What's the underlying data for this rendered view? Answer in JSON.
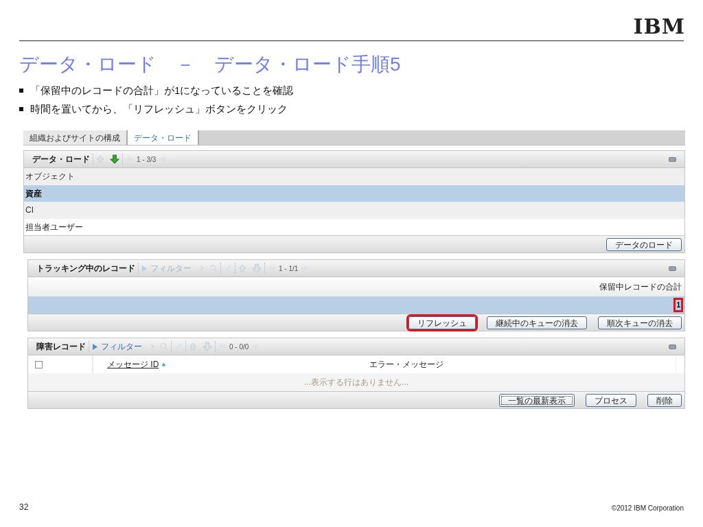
{
  "logo": "IBM",
  "title": "データ・ロード　－　データ・ロード手順5",
  "bullets": [
    "「保留中のレコードの合計」が1になっていることを確認",
    "時間を置いてから、「リフレッシュ」ボタンをクリック"
  ],
  "tabs": [
    {
      "label": "組織およびサイトの構成",
      "selected": false
    },
    {
      "label": "データ・ロード",
      "selected": true
    }
  ],
  "panels": [
    {
      "kind": "list",
      "title": "データ・ロード",
      "move_down_enabled": true,
      "pager": "1 - 3/3",
      "rows": [
        {
          "text": "オブジェクト",
          "selected": false
        },
        {
          "text": "資産",
          "selected": true
        },
        {
          "text": "CI",
          "selected": false
        },
        {
          "text": "担当者ユーザー",
          "selected": false
        }
      ],
      "buttons": [
        {
          "label": "データのロード",
          "highlighted": false,
          "focused": false
        }
      ]
    },
    {
      "kind": "tracking",
      "title": "トラッキング中のレコード",
      "filter": "フィルター",
      "filter_enabled": false,
      "move_down_enabled": false,
      "pager": "1 - 1/1",
      "column": "保留中レコードの合計",
      "value": "1",
      "value_highlighted": true,
      "buttons": [
        {
          "label": "リフレッシュ",
          "highlighted": true,
          "focused": false
        },
        {
          "label": "継続中のキューの消去",
          "highlighted": false,
          "focused": false
        },
        {
          "label": "順次キューの消去",
          "highlighted": false,
          "focused": false
        }
      ]
    },
    {
      "kind": "errors",
      "title": "障害レコード",
      "filter": "フィルター",
      "filter_enabled": true,
      "move_down_enabled": false,
      "pager": "0 - 0/0",
      "select_all_checked": false,
      "columns": [
        "メッセージ ID",
        "エラー・メッセージ"
      ],
      "empty_message": "...表示する行はありません...",
      "buttons": [
        {
          "label": "一覧の最新表示",
          "highlighted": false,
          "focused": true
        },
        {
          "label": "プロセス",
          "highlighted": false,
          "focused": false
        },
        {
          "label": "削除",
          "highlighted": false,
          "focused": false
        }
      ]
    }
  ],
  "footer": {
    "page": "32",
    "copyright": "©2012 IBM Corporation"
  }
}
